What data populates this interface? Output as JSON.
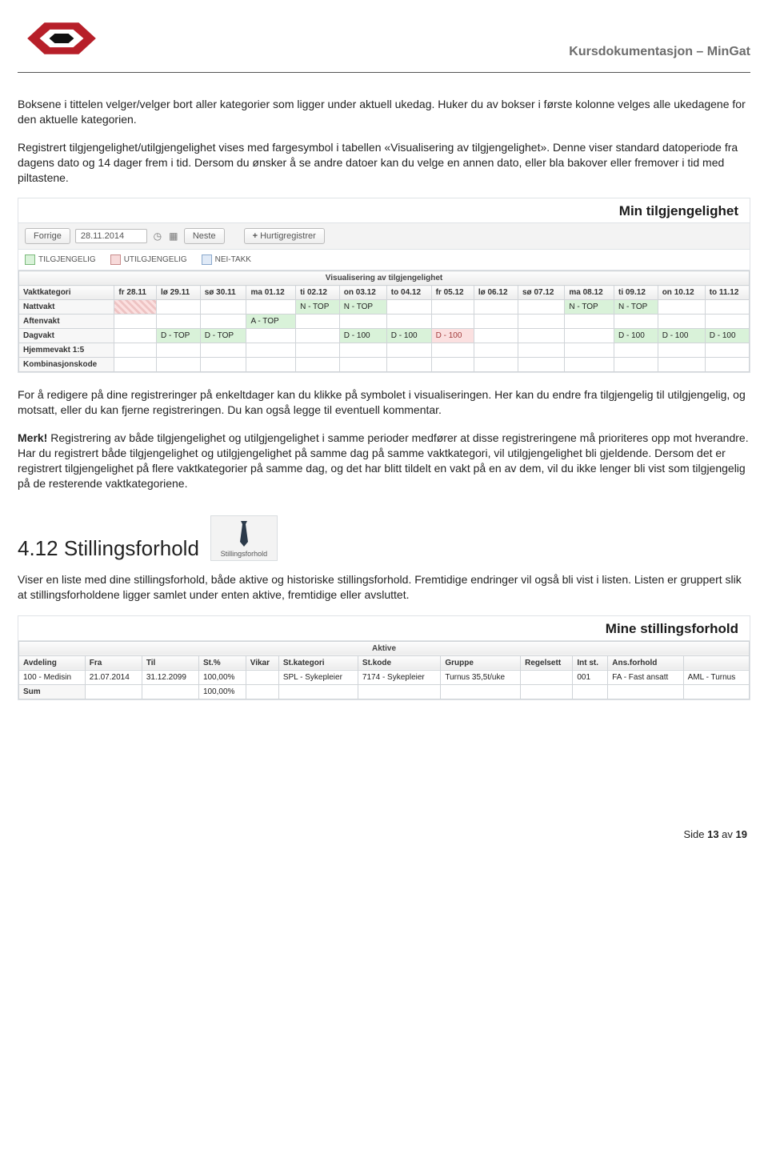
{
  "doc_title": "Kursdokumentasjon – MinGat",
  "para1": "Boksene i tittelen velger/velger bort aller kategorier som ligger under aktuell ukedag. Huker du av bokser i første kolonne velges alle ukedagene for den aktuelle kategorien.",
  "para2": "Registrert tilgjengelighet/utilgjengelighet vises med fargesymbol i tabellen «Visualisering av tilgjengelighet». Denne viser standard datoperiode fra dagens dato og 14 dager frem i tid. Dersom du ønsker å se andre datoer kan du velge en annen dato, eller bla bakover eller fremover i tid med piltastene.",
  "panel1": {
    "title": "Min tilgjengelighet",
    "prev": "Forrige",
    "date": "28.11.2014",
    "next": "Neste",
    "hurtig": "Hurtigregistrer",
    "legend": {
      "til": "TILGJENGELIG",
      "util": "UTILGJENGELIG",
      "nei": "NEI-TAKK"
    },
    "table_title": "Visualisering av tilgjengelighet",
    "cols": [
      "Vaktkategori",
      "fr 28.11",
      "lø 29.11",
      "sø 30.11",
      "ma 01.12",
      "ti 02.12",
      "on 03.12",
      "to 04.12",
      "fr 05.12",
      "lø 06.12",
      "sø 07.12",
      "ma 08.12",
      "ti 09.12",
      "on 10.12",
      "to 11.12"
    ],
    "rows": [
      {
        "label": "Nattvakt",
        "cells": [
          "",
          "",
          "",
          "",
          "N - TOP",
          "N - TOP",
          "",
          "",
          "",
          "",
          "N - TOP",
          "N - TOP",
          "",
          ""
        ]
      },
      {
        "label": "Aftenvakt",
        "cells": [
          "",
          "",
          "",
          "A - TOP",
          "",
          "",
          "",
          "",
          "",
          "",
          "",
          "",
          "",
          ""
        ]
      },
      {
        "label": "Dagvakt",
        "cells": [
          "",
          "D - TOP",
          "D - TOP",
          "",
          "",
          "D - 100",
          "D - 100",
          "D - 100",
          "",
          "",
          "",
          "D - 100",
          "D - 100",
          "D - 100"
        ]
      },
      {
        "label": "Hjemmevakt 1:5",
        "cells": [
          "",
          "",
          "",
          "",
          "",
          "",
          "",
          "",
          "",
          "",
          "",
          "",
          "",
          ""
        ]
      },
      {
        "label": "Kombinasjonskode",
        "cells": [
          "",
          "",
          "",
          "",
          "",
          "",
          "",
          "",
          "",
          "",
          "",
          "",
          "",
          ""
        ]
      }
    ]
  },
  "para3": "For å redigere på dine registreringer på enkeltdager kan du klikke på symbolet i visualiseringen. Her kan du endre fra tilgjengelig til utilgjengelig, og motsatt, eller du kan fjerne registreringen. Du kan også legge til eventuell kommentar.",
  "para4a": "Merk!",
  "para4b": " Registrering av både tilgjengelighet og utilgjengelighet i samme perioder medfører at disse registreringene må prioriteres opp mot hverandre. Har du registrert både tilgjengelighet og utilgjengelighet på samme dag på samme vaktkategori, vil utilgjengelighet bli gjeldende. Dersom det er registrert tilgjengelighet på flere vaktkategorier på samme dag, og det har blitt tildelt en vakt på en av dem, vil du ikke lenger bli vist som tilgjengelig på de resterende vaktkategoriene.",
  "section412": "4.12 Stillingsforhold",
  "tile_label": "Stillingsforhold",
  "para5": "Viser en liste med dine stillingsforhold, både aktive og historiske stillingsforhold. Fremtidige endringer vil også bli vist i listen. Listen er gruppert slik at stillingsforholdene ligger samlet under enten aktive, fremtidige eller avsluttet.",
  "panel2": {
    "title": "Mine stillingsforhold",
    "group": "Aktive",
    "cols": [
      "Avdeling",
      "Fra",
      "Til",
      "St.%",
      "Vikar",
      "St.kategori",
      "St.kode",
      "Gruppe",
      "Regelsett",
      "Int st.",
      "Ans.forhold",
      ""
    ],
    "row": [
      "100 - Medisin",
      "21.07.2014",
      "31.12.2099",
      "100,00%",
      "",
      "SPL - Sykepleier",
      "7174 - Sykepleier",
      "Turnus 35,5t/uke",
      "",
      "001",
      "FA - Fast ansatt",
      "AML - Turnus"
    ],
    "sum_label": "Sum",
    "sum_val": "100,00%"
  },
  "footer_a": "Side ",
  "footer_b": "13",
  "footer_c": " av ",
  "footer_d": "19"
}
